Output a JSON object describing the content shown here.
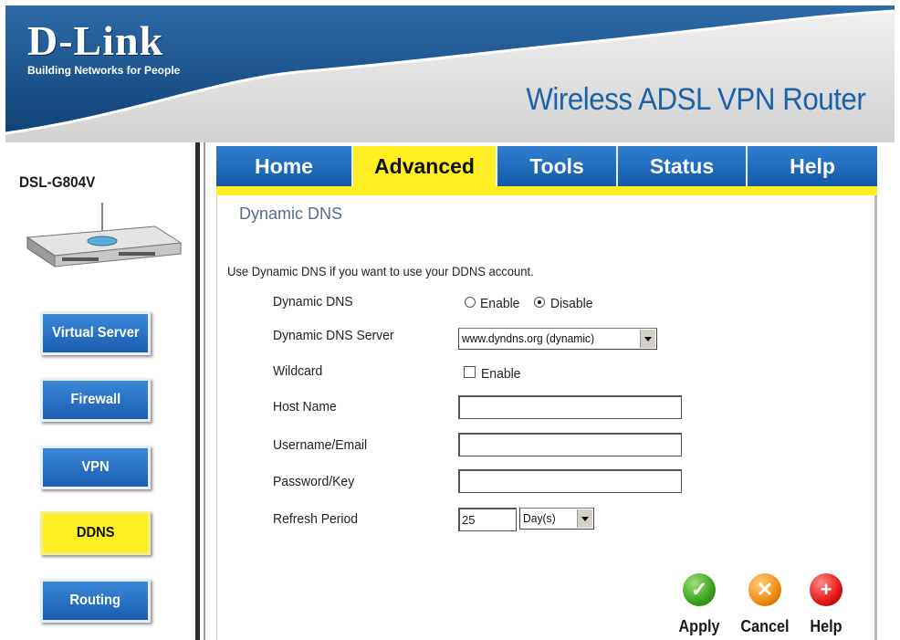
{
  "header": {
    "logo_main": "D-Link",
    "logo_sub": "Building Networks for People",
    "product_title": "Wireless ADSL VPN Router"
  },
  "sidebar": {
    "model": "DSL-G804V",
    "buttons": [
      {
        "label": "Virtual Server",
        "active": false
      },
      {
        "label": "Firewall",
        "active": false
      },
      {
        "label": "VPN",
        "active": false
      },
      {
        "label": "DDNS",
        "active": true
      },
      {
        "label": "Routing",
        "active": false
      }
    ]
  },
  "tabs": [
    {
      "label": "Home",
      "active": false
    },
    {
      "label": "Advanced",
      "active": true
    },
    {
      "label": "Tools",
      "active": false
    },
    {
      "label": "Status",
      "active": false
    },
    {
      "label": "Help",
      "active": false
    }
  ],
  "content": {
    "title": "Dynamic DNS",
    "intro": "Use Dynamic DNS if you want to use your DDNS account.",
    "dynamic_dns": {
      "label": "Dynamic DNS",
      "enable": "Enable",
      "disable": "Disable",
      "selected": "Disable"
    },
    "server": {
      "label": "Dynamic DNS Server",
      "value": "www.dyndns.org (dynamic)"
    },
    "wildcard": {
      "label": "Wildcard",
      "option": "Enable",
      "checked": false
    },
    "host_name": {
      "label": "Host Name",
      "value": ""
    },
    "username": {
      "label": "Username/Email",
      "value": ""
    },
    "password": {
      "label": "Password/Key",
      "value": ""
    },
    "refresh": {
      "label": "Refresh Period",
      "value": "25",
      "unit": "Day(s)"
    }
  },
  "actions": {
    "apply": "Apply",
    "cancel": "Cancel",
    "help": "Help"
  },
  "colors": {
    "accent_blue": "#1c62a8",
    "active_yellow": "#ffee22"
  }
}
